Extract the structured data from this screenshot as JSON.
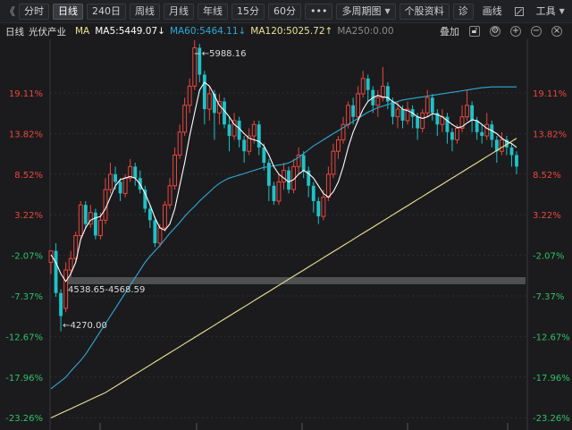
{
  "toolbar": {
    "back_arrow": "《",
    "period_buttons": [
      {
        "label": "分时",
        "active": false
      },
      {
        "label": "日线",
        "active": true
      },
      {
        "label": "240日",
        "active": false
      },
      {
        "label": "周线",
        "active": false
      },
      {
        "label": "月线",
        "active": false
      },
      {
        "label": "年线",
        "active": false
      },
      {
        "label": "15分",
        "active": false
      },
      {
        "label": "60分",
        "active": false
      }
    ],
    "more_label": "•••",
    "multi_period_label": "多周期图",
    "stock_info_label": "个股资料",
    "diagnose_label": "诊",
    "draw_label": "画线",
    "tools_label": "工具",
    "forward_arrow": "》"
  },
  "infobar": {
    "period": "日线",
    "name": "光伏产业",
    "ma_label": "MA",
    "ma5": "MA5:5449.07↓",
    "ma60": "MA60:5464.11↓",
    "ma120": "MA120:5025.72↑",
    "ma250": "MA250:0.00",
    "overlay_label": "叠加",
    "colors": {
      "ma5": "#ffffff",
      "ma60": "#2fa9d4",
      "ma120": "#e9e493",
      "ma250": "#b84fc4"
    }
  },
  "colors": {
    "up": "#e8473f",
    "down": "#1fc2c8",
    "ma5": "#ffffff",
    "ma60": "#2fa9d4",
    "ma120": "#e9e493",
    "grid": "#3a3a3e"
  },
  "axis": {
    "ticks": [
      "19.11%",
      "13.82%",
      "8.52%",
      "3.22%",
      "-2.07%",
      "-7.37%",
      "-12.67%",
      "-17.96%",
      "-23.26%"
    ]
  },
  "annotations": {
    "high": "5988.16",
    "low": "4270.00",
    "range": "4538.65-4568.59"
  },
  "chart_data": {
    "type": "candlestick",
    "y_unit": "% change",
    "ylim": [
      -23.26,
      22.0
    ],
    "high_value": 5988.16,
    "low_value": 4270.0,
    "range_band": [
      4538.65,
      4568.59
    ],
    "candles": [
      [
        -3.0,
        -1.5,
        -2.5,
        -4.5
      ],
      [
        -1.5,
        -7.0,
        -7.5,
        -0.5
      ],
      [
        -7.0,
        -10.0,
        -12.0,
        -6.5
      ],
      [
        -9.0,
        -4.0,
        -9.5,
        -3.0
      ],
      [
        -4.0,
        -2.5,
        -5.0,
        -1.5
      ],
      [
        -2.5,
        0.5,
        -3.0,
        1.0
      ],
      [
        0.5,
        4.5,
        0.0,
        5.0
      ],
      [
        4.5,
        2.0,
        1.5,
        5.0
      ],
      [
        2.0,
        3.5,
        1.5,
        4.5
      ],
      [
        3.5,
        0.5,
        0.0,
        4.0
      ],
      [
        0.5,
        2.5,
        0.0,
        3.5
      ],
      [
        2.5,
        6.5,
        2.0,
        8.0
      ],
      [
        6.5,
        8.5,
        6.0,
        10.0
      ],
      [
        8.5,
        7.5,
        6.5,
        9.5
      ],
      [
        7.5,
        6.0,
        5.0,
        8.0
      ],
      [
        6.0,
        8.0,
        5.5,
        8.5
      ],
      [
        8.0,
        9.5,
        7.5,
        10.5
      ],
      [
        9.5,
        8.0,
        7.0,
        10.0
      ],
      [
        8.0,
        6.5,
        6.0,
        9.0
      ],
      [
        6.5,
        4.0,
        3.5,
        7.0
      ],
      [
        4.0,
        2.5,
        1.5,
        4.5
      ],
      [
        2.5,
        -0.5,
        -1.0,
        3.0
      ],
      [
        -0.5,
        1.5,
        -1.0,
        2.0
      ],
      [
        1.5,
        4.5,
        1.0,
        5.0
      ],
      [
        4.5,
        7.0,
        4.0,
        8.0
      ],
      [
        7.0,
        11.0,
        6.5,
        12.0
      ],
      [
        11.0,
        14.0,
        10.5,
        15.0
      ],
      [
        14.0,
        17.5,
        13.5,
        18.5
      ],
      [
        17.5,
        20.0,
        16.5,
        21.0
      ],
      [
        20.0,
        25.0,
        19.5,
        26.0
      ],
      [
        25.0,
        21.5,
        20.5,
        25.5
      ],
      [
        21.5,
        17.0,
        15.0,
        22.0
      ],
      [
        17.0,
        19.0,
        15.5,
        20.0
      ],
      [
        19.0,
        16.5,
        13.0,
        19.5
      ],
      [
        16.5,
        18.0,
        15.0,
        19.0
      ],
      [
        18.0,
        15.0,
        14.5,
        18.5
      ],
      [
        15.0,
        13.5,
        11.5,
        16.0
      ],
      [
        13.5,
        15.5,
        13.0,
        16.5
      ],
      [
        15.5,
        13.0,
        12.0,
        16.0
      ],
      [
        13.0,
        11.5,
        10.0,
        13.5
      ],
      [
        11.5,
        13.5,
        11.0,
        14.5
      ],
      [
        13.5,
        15.0,
        12.5,
        15.5
      ],
      [
        15.0,
        12.0,
        11.0,
        15.5
      ],
      [
        12.0,
        10.0,
        9.0,
        12.5
      ],
      [
        10.0,
        7.0,
        5.0,
        10.5
      ],
      [
        7.0,
        5.0,
        4.5,
        7.5
      ],
      [
        5.0,
        7.5,
        4.5,
        8.5
      ],
      [
        7.5,
        9.0,
        6.5,
        10.0
      ],
      [
        9.0,
        6.5,
        6.0,
        9.5
      ],
      [
        6.5,
        9.5,
        6.0,
        10.5
      ],
      [
        9.5,
        11.0,
        8.5,
        12.0
      ],
      [
        11.0,
        9.0,
        8.0,
        11.5
      ],
      [
        9.0,
        7.0,
        5.5,
        9.5
      ],
      [
        7.0,
        5.0,
        3.5,
        7.5
      ],
      [
        5.0,
        3.0,
        2.0,
        5.5
      ],
      [
        3.0,
        5.5,
        2.5,
        6.5
      ],
      [
        5.5,
        8.5,
        5.0,
        9.5
      ],
      [
        8.5,
        11.5,
        8.0,
        12.5
      ],
      [
        11.5,
        13.0,
        10.5,
        13.5
      ],
      [
        13.0,
        15.0,
        12.5,
        16.0
      ],
      [
        15.0,
        17.5,
        14.5,
        18.0
      ],
      [
        17.5,
        16.0,
        15.0,
        18.5
      ],
      [
        16.0,
        19.0,
        15.5,
        20.0
      ],
      [
        19.0,
        21.0,
        18.5,
        22.0
      ],
      [
        21.0,
        19.5,
        18.0,
        21.5
      ],
      [
        19.5,
        17.5,
        16.5,
        20.0
      ],
      [
        17.5,
        18.5,
        16.0,
        19.5
      ],
      [
        18.5,
        20.0,
        18.0,
        22.5
      ],
      [
        20.0,
        18.0,
        17.0,
        20.5
      ],
      [
        18.0,
        16.0,
        15.0,
        18.5
      ],
      [
        16.0,
        17.0,
        14.5,
        18.0
      ],
      [
        17.0,
        15.5,
        14.5,
        17.5
      ],
      [
        15.5,
        17.0,
        15.0,
        18.0
      ],
      [
        17.0,
        16.0,
        14.5,
        17.5
      ],
      [
        16.0,
        14.5,
        13.0,
        16.5
      ],
      [
        14.5,
        16.5,
        14.0,
        17.0
      ],
      [
        16.5,
        18.5,
        16.0,
        19.5
      ],
      [
        18.5,
        16.5,
        15.5,
        19.0
      ],
      [
        16.5,
        15.0,
        13.5,
        17.0
      ],
      [
        15.0,
        16.0,
        14.0,
        17.0
      ],
      [
        16.0,
        14.0,
        12.5,
        16.5
      ],
      [
        14.0,
        13.0,
        11.5,
        14.5
      ],
      [
        13.0,
        14.5,
        12.5,
        15.0
      ],
      [
        14.5,
        16.0,
        14.0,
        17.5
      ],
      [
        16.0,
        17.5,
        15.5,
        19.5
      ],
      [
        17.5,
        15.5,
        14.0,
        18.0
      ],
      [
        15.5,
        14.0,
        13.0,
        16.0
      ],
      [
        14.0,
        13.5,
        12.5,
        15.0
      ],
      [
        13.5,
        15.0,
        13.0,
        16.5
      ],
      [
        15.0,
        13.0,
        12.0,
        15.5
      ],
      [
        13.0,
        11.5,
        10.0,
        13.5
      ],
      [
        11.5,
        13.0,
        11.0,
        14.0
      ],
      [
        13.0,
        12.0,
        11.0,
        13.5
      ],
      [
        12.0,
        11.0,
        9.5,
        12.5
      ],
      [
        11.0,
        9.5,
        8.5,
        11.5
      ]
    ],
    "ma5": [
      -2,
      -3,
      -4.5,
      -5.5,
      -4.5,
      -3,
      0,
      1.5,
      2.5,
      2.8,
      3,
      4,
      5.5,
      7,
      7.8,
      8,
      8.2,
      8,
      7.2,
      6,
      4.5,
      2.8,
      1.5,
      1.2,
      2,
      4,
      7,
      10,
      13.5,
      16.5,
      19.5,
      20.5,
      20,
      18.8,
      17.5,
      16.8,
      16,
      15,
      14.5,
      13.8,
      13.2,
      13,
      12.8,
      12.2,
      11,
      9.5,
      8.5,
      8,
      7.5,
      7.8,
      8.5,
      9,
      8.6,
      8,
      7,
      6,
      5.5,
      6.2,
      7.5,
      9.5,
      12,
      14,
      15.5,
      17,
      18,
      18.5,
      18.8,
      18.6,
      18.5,
      18,
      17.6,
      17,
      16.8,
      16.5,
      16,
      15.8,
      16,
      16.4,
      16.3,
      16,
      15.5,
      15,
      14.6,
      14.7,
      15.2,
      15.6,
      15.5,
      15,
      14.5,
      14.2,
      13.8,
      13.2,
      12.8,
      12.5,
      12
    ],
    "ma60": [
      -19.5,
      -19,
      -18.5,
      -18,
      -17.2,
      -16.5,
      -15.8,
      -15,
      -14,
      -13,
      -12,
      -11,
      -10,
      -9,
      -8,
      -7,
      -6,
      -5,
      -4,
      -3,
      -2.2,
      -1.5,
      -0.8,
      0,
      0.8,
      1.5,
      2.2,
      3,
      3.7,
      4.3,
      5,
      5.6,
      6.2,
      6.8,
      7.3,
      7.7,
      8,
      8.2,
      8.4,
      8.6,
      8.8,
      9,
      9.2,
      9.4,
      9.5,
      9.6,
      9.7,
      9.8,
      10,
      10.3,
      10.7,
      11.2,
      11.7,
      12.2,
      12.6,
      13,
      13.4,
      13.8,
      14.2,
      14.6,
      15,
      15.4,
      15.8,
      16.2,
      16.6,
      16.9,
      17.2,
      17.4,
      17.6,
      17.8,
      18,
      18.2,
      18.3,
      18.4,
      18.5,
      18.6,
      18.7,
      18.8,
      18.9,
      19,
      19.1,
      19.2,
      19.3,
      19.4,
      19.5,
      19.6,
      19.7,
      19.8,
      19.85,
      19.9,
      19.9,
      19.9,
      19.9,
      19.9,
      19.9
    ],
    "ma120": [
      -23.3,
      -23,
      -22.7,
      -22.4,
      -22.1,
      -21.8,
      -21.5,
      -21.2,
      -20.9,
      -20.6,
      -20.3,
      -20,
      -19.6,
      -19.2,
      -18.8,
      -18.4,
      -18,
      -17.6,
      -17.2,
      -16.8,
      -16.4,
      -16,
      -15.6,
      -15.2,
      -14.8,
      -14.4,
      -14,
      -13.6,
      -13.2,
      -12.8,
      -12.4,
      -12,
      -11.6,
      -11.2,
      -10.8,
      -10.4,
      -10,
      -9.6,
      -9.2,
      -8.8,
      -8.4,
      -8,
      -7.6,
      -7.2,
      -6.8,
      -6.4,
      -6,
      -5.6,
      -5.2,
      -4.8,
      -4.4,
      -4,
      -3.6,
      -3.2,
      -2.8,
      -2.4,
      -2,
      -1.6,
      -1.2,
      -0.8,
      -0.4,
      0,
      0.4,
      0.8,
      1.2,
      1.6,
      2,
      2.4,
      2.8,
      3.2,
      3.6,
      4,
      4.4,
      4.8,
      5.2,
      5.6,
      6,
      6.4,
      6.8,
      7.2,
      7.6,
      8,
      8.4,
      8.8,
      9.2,
      9.6,
      10,
      10.4,
      10.8,
      11.2,
      11.6,
      12,
      12.4,
      12.8,
      13.2
    ]
  }
}
